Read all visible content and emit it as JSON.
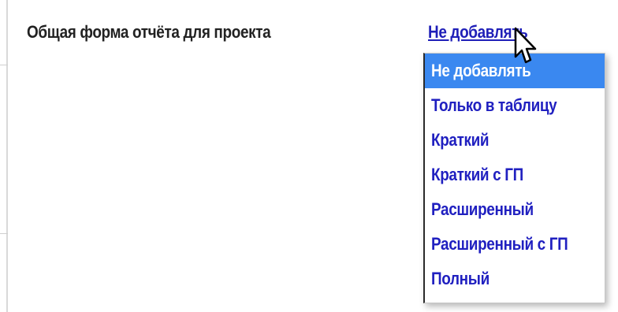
{
  "form": {
    "label": "Общая форма отчёта для проекта",
    "selected_value": "Не добавлять"
  },
  "dropdown": {
    "options": [
      {
        "label": "Не добавлять",
        "selected": true
      },
      {
        "label": "Только в таблицу",
        "selected": false
      },
      {
        "label": "Краткий",
        "selected": false
      },
      {
        "label": "Краткий с ГП",
        "selected": false
      },
      {
        "label": "Расширенный",
        "selected": false
      },
      {
        "label": "Расширенный с ГП",
        "selected": false
      },
      {
        "label": "Полный",
        "selected": false
      }
    ]
  },
  "icons": {
    "cursor": "mouse-pointer-icon"
  },
  "colors": {
    "link": "#1f1fb8",
    "option_text": "#2020c0",
    "selected_bg": "#3a88f0",
    "selected_text": "#ffffff",
    "label_text": "#222222"
  }
}
